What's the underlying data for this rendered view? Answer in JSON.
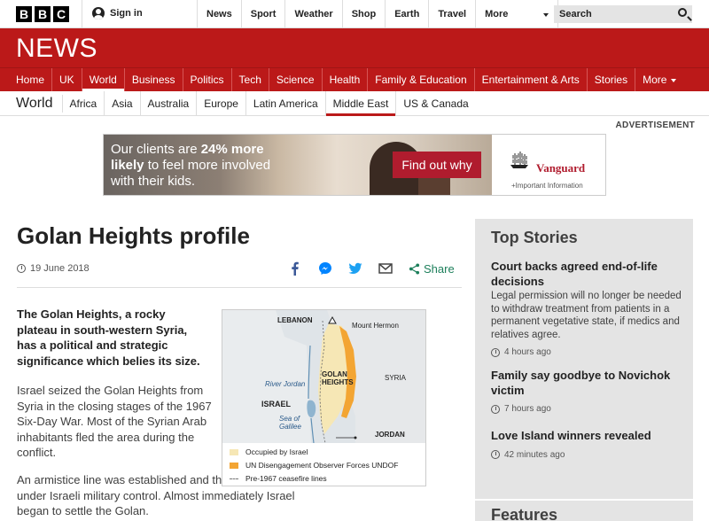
{
  "topbar": {
    "logo_letters": [
      "B",
      "B",
      "C"
    ],
    "signin_label": "Sign in",
    "nav": [
      "News",
      "Sport",
      "Weather",
      "Shop",
      "Earth",
      "Travel",
      "More"
    ],
    "search_placeholder": "Search"
  },
  "banner": {
    "wordmark": "NEWS",
    "color": "#bb1919"
  },
  "main_nav": {
    "items": [
      "Home",
      "UK",
      "World",
      "Business",
      "Politics",
      "Tech",
      "Science",
      "Health",
      "Family & Education",
      "Entertainment & Arts",
      "Stories",
      "More"
    ],
    "active": "World"
  },
  "sub_nav": {
    "section_title": "World",
    "items": [
      "Africa",
      "Asia",
      "Australia",
      "Europe",
      "Latin America",
      "Middle East",
      "US & Canada"
    ],
    "active": "Middle East"
  },
  "ad": {
    "label": "ADVERTISEMENT",
    "headline_pre": "Our clients are ",
    "headline_highlight": "24% more likely",
    "headline_post": " to feel more involved with their kids.",
    "cta": "Find out why",
    "brand": "Vanguard",
    "brand_sub": "+Important Information"
  },
  "article": {
    "title": "Golan Heights profile",
    "date": "19 June 2018",
    "share_label": "Share",
    "lead": "The Golan Heights, a rocky plateau in south-western Syria, has a political and strategic significance which belies its size.",
    "paragraph1": "Israel seized the Golan Heights from Syria in the closing stages of the 1967 Six-Day War. Most of the Syrian Arab inhabitants fled the area during the conflict.",
    "paragraph2": "An armistice line was established and the region came under Israeli military control. Almost immediately Israel began to settle the Golan."
  },
  "map": {
    "labels": {
      "lebanon": "LEBANON",
      "mount_hermon": "Mount Hermon",
      "golan": "GOLAN HEIGHTS",
      "syria": "SYRIA",
      "river_jordan": "River Jordan",
      "israel": "ISRAEL",
      "sea_of_galilee": "Sea of Galilee",
      "jordan": "JORDAN"
    },
    "legend": [
      {
        "label": "Occupied by Israel",
        "color": "#f6e7b5"
      },
      {
        "label": "UN Disengagement Observer Forces UNDOF",
        "color": "#f3a533"
      },
      {
        "label": "Pre-1967 ceasefire lines",
        "color": "#777777"
      }
    ]
  },
  "sidebar": {
    "heading": "Top Stories",
    "stories": [
      {
        "title": "Court backs agreed end-of-life decisions",
        "summary": "Legal permission will no longer be needed to withdraw treatment from patients in a permanent vegetative state, if medics and relatives agree.",
        "time": "4 hours ago"
      },
      {
        "title": "Family say goodbye to Novichok victim",
        "time": "7 hours ago"
      },
      {
        "title": "Love Island winners revealed",
        "time": "42 minutes ago"
      }
    ],
    "features_heading": "Features"
  }
}
